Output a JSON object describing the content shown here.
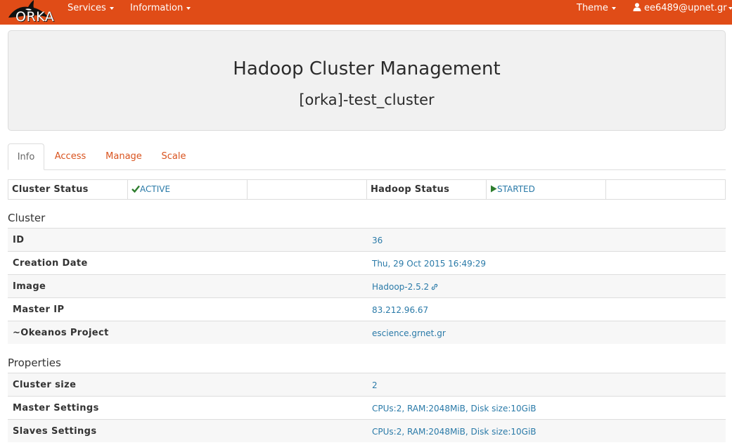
{
  "navbar": {
    "brand": "ORKA",
    "menus": [
      {
        "label": "Services"
      },
      {
        "label": "Information"
      }
    ],
    "theme_label": "Theme",
    "user_label": "ee6489@upnet.gr"
  },
  "header": {
    "title": "Hadoop Cluster Management",
    "subtitle": "[orka]-test_cluster"
  },
  "tabs": [
    {
      "label": "Info",
      "active": true
    },
    {
      "label": "Access"
    },
    {
      "label": "Manage"
    },
    {
      "label": "Scale"
    }
  ],
  "status": {
    "cluster_status_label": "Cluster Status",
    "cluster_status_value": "ACTIVE",
    "hadoop_status_label": "Hadoop Status",
    "hadoop_status_value": "STARTED",
    "status_color": "#2e7d2e"
  },
  "cluster": {
    "title": "Cluster",
    "rows": [
      {
        "key": "ID",
        "value": "36"
      },
      {
        "key": "Creation Date",
        "value": "Thu, 29 Oct 2015 16:49:29"
      },
      {
        "key": "Image",
        "value": "Hadoop-2.5.2"
      },
      {
        "key": "Master IP",
        "value": "83.212.96.67"
      },
      {
        "key": "~Okeanos Project",
        "value": "escience.grnet.gr"
      }
    ]
  },
  "properties": {
    "title": "Properties",
    "rows": [
      {
        "key": "Cluster size",
        "value": "2"
      },
      {
        "key": "Master Settings",
        "value": "CPUs:2, RAM:2048MiB, Disk size:10GiB"
      },
      {
        "key": "Slaves Settings",
        "value": "CPUs:2, RAM:2048MiB, Disk size:10GiB"
      }
    ]
  },
  "colors": {
    "navbar": "#e04c17",
    "link": "#2a7aa8",
    "tab_link": "#d9531e"
  }
}
